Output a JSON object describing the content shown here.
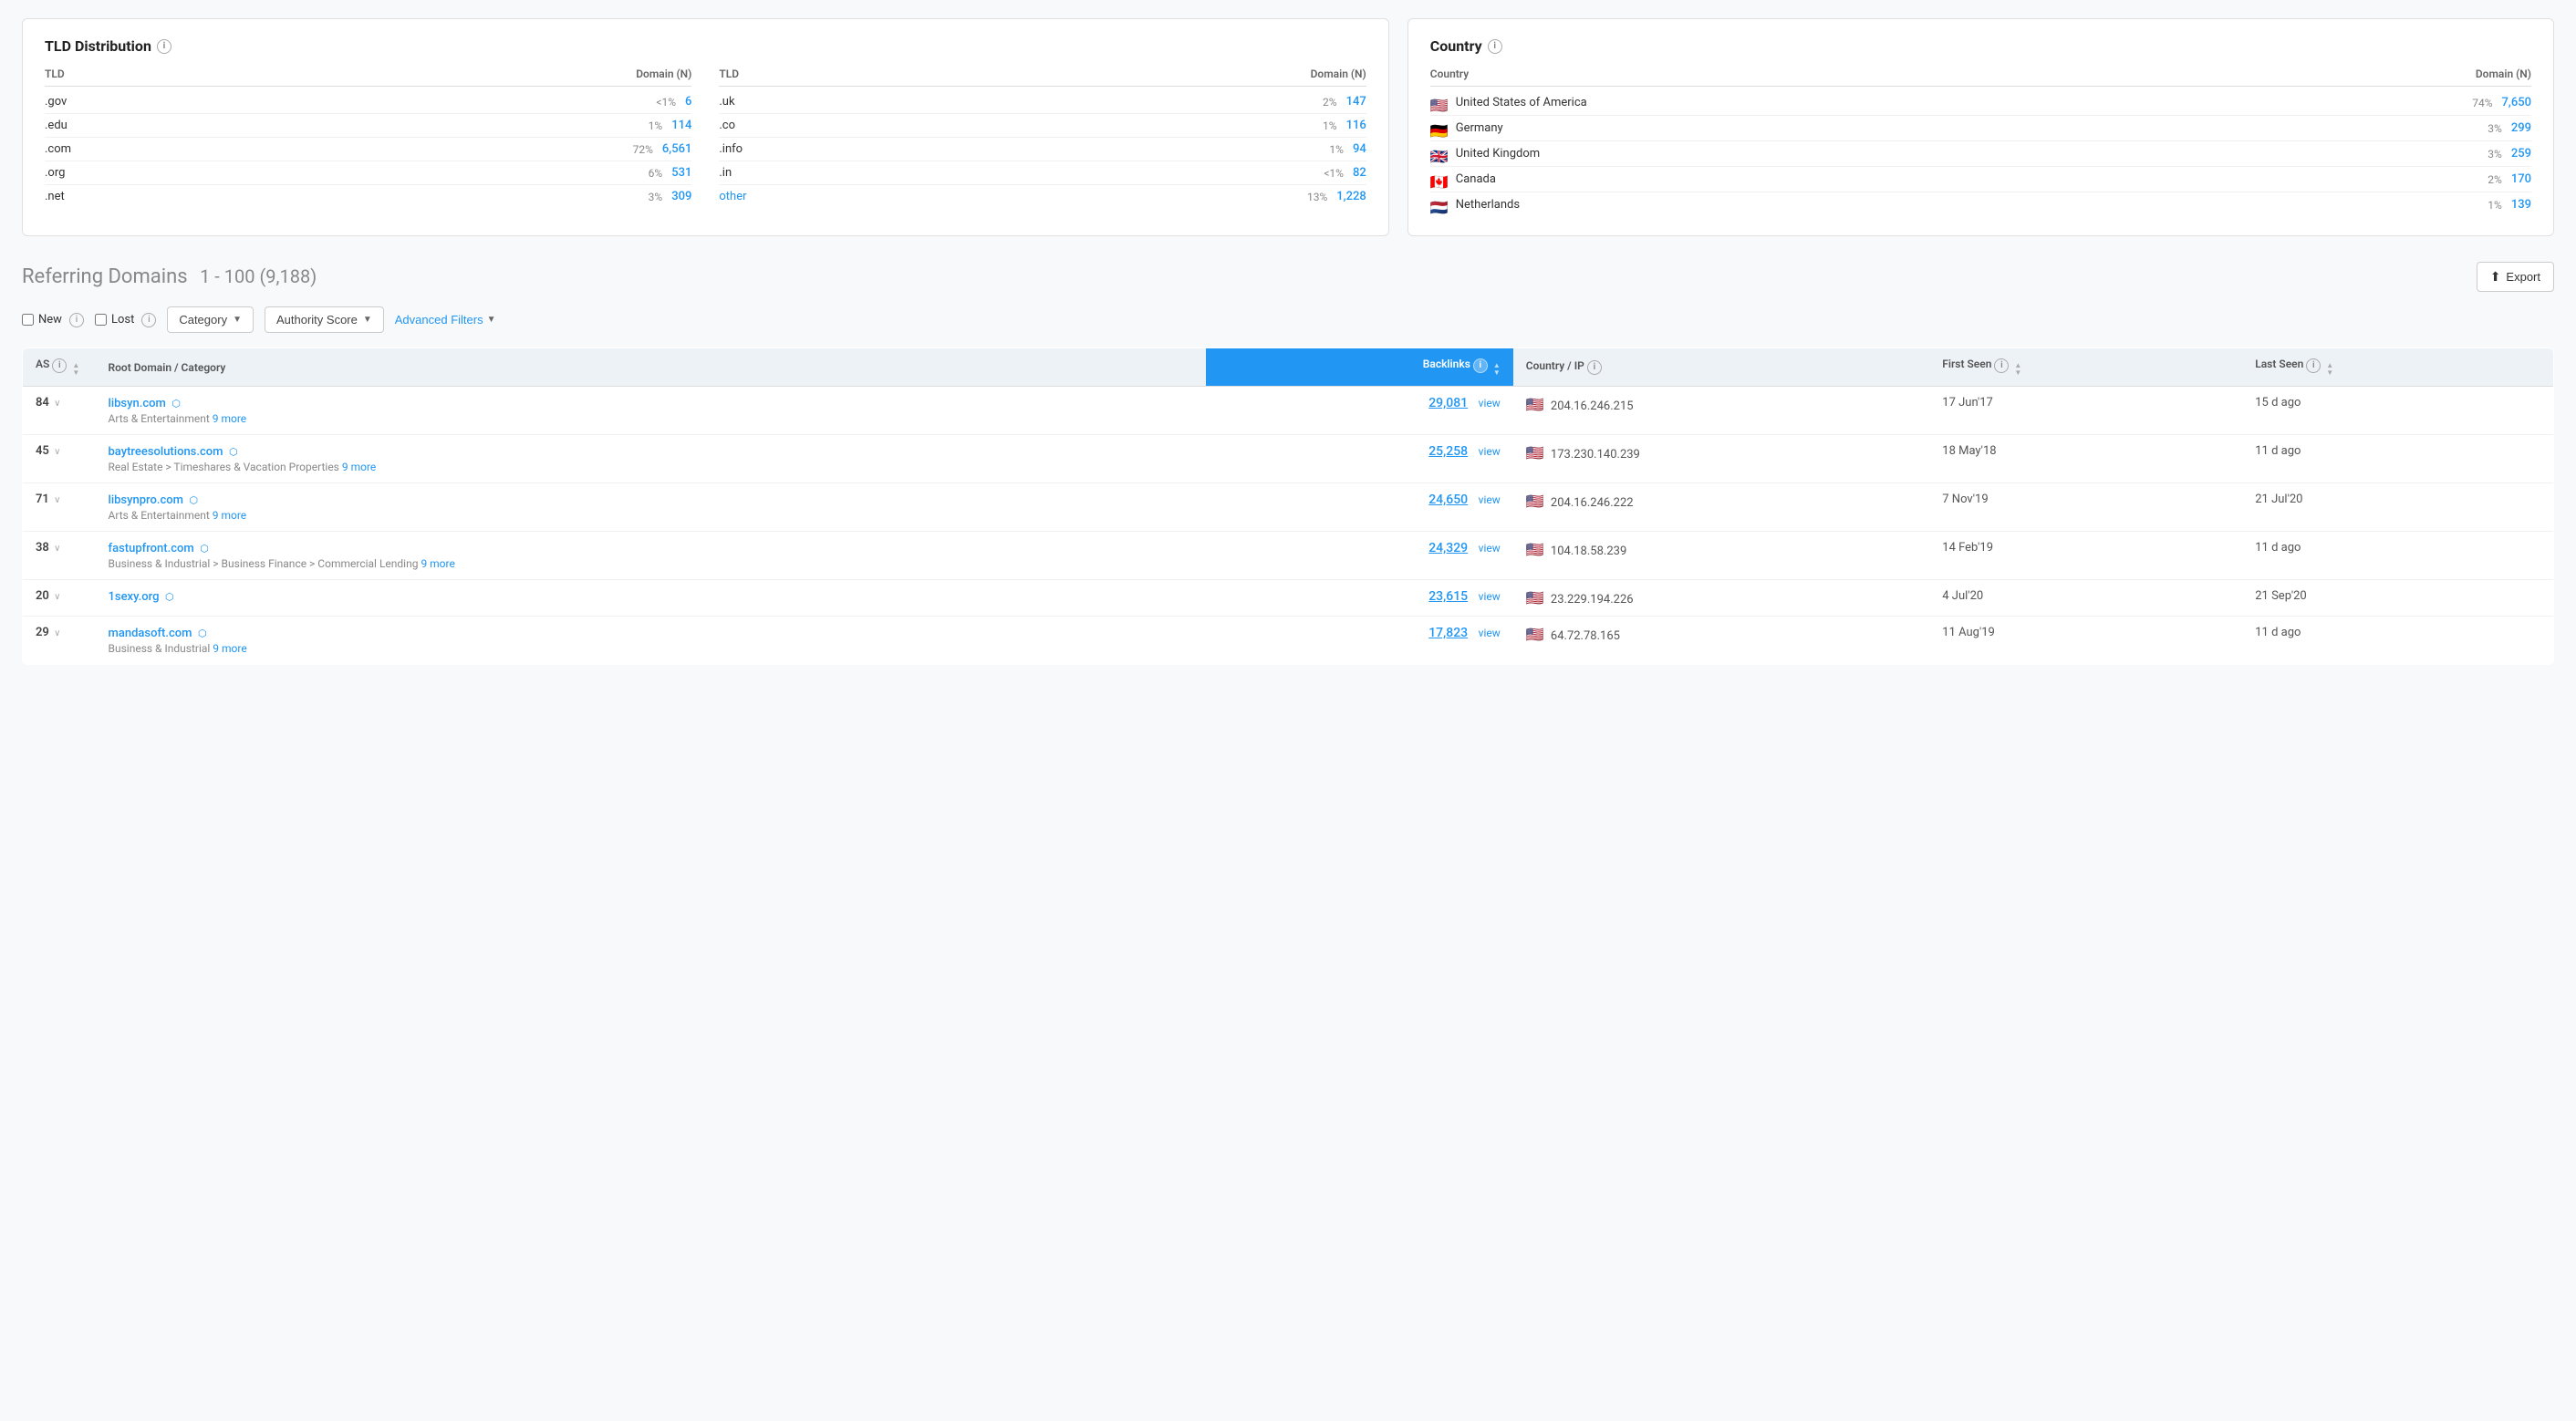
{
  "tld_section": {
    "title": "TLD Distribution",
    "col1": {
      "header_tld": "TLD",
      "header_domain": "Domain (N)",
      "rows": [
        {
          "tld": ".gov",
          "pct": "<1%",
          "count": "6"
        },
        {
          "tld": ".edu",
          "pct": "1%",
          "count": "114"
        },
        {
          "tld": ".com",
          "pct": "72%",
          "count": "6,561"
        },
        {
          "tld": ".org",
          "pct": "6%",
          "count": "531"
        },
        {
          "tld": ".net",
          "pct": "3%",
          "count": "309"
        }
      ]
    },
    "col2": {
      "header_tld": "TLD",
      "header_domain": "Domain (N)",
      "rows": [
        {
          "tld": ".uk",
          "pct": "2%",
          "count": "147"
        },
        {
          "tld": ".co",
          "pct": "1%",
          "count": "116"
        },
        {
          "tld": ".info",
          "pct": "1%",
          "count": "94"
        },
        {
          "tld": ".in",
          "pct": "<1%",
          "count": "82"
        },
        {
          "tld": "other",
          "pct": "13%",
          "count": "1,228",
          "is_link": true
        }
      ]
    }
  },
  "country_section": {
    "title": "Country",
    "header_country": "Country",
    "header_domain": "Domain (N)",
    "rows": [
      {
        "flag": "🇺🇸",
        "name": "United States of America",
        "pct": "74%",
        "count": "7,650"
      },
      {
        "flag": "🇩🇪",
        "name": "Germany",
        "pct": "3%",
        "count": "299"
      },
      {
        "flag": "🇬🇧",
        "name": "United Kingdom",
        "pct": "3%",
        "count": "259"
      },
      {
        "flag": "🇨🇦",
        "name": "Canada",
        "pct": "2%",
        "count": "170"
      },
      {
        "flag": "🇳🇱",
        "name": "Netherlands",
        "pct": "1%",
        "count": "139"
      }
    ]
  },
  "referring_domains": {
    "title": "Referring Domains",
    "range": "1 - 100 (9,188)",
    "export_label": "Export",
    "filters": {
      "new_label": "New",
      "lost_label": "Lost",
      "category_label": "Category",
      "authority_score_label": "Authority Score",
      "advanced_filters_label": "Advanced Filters"
    },
    "table": {
      "headers": [
        {
          "key": "as",
          "label": "AS",
          "sortable": true
        },
        {
          "key": "root_domain",
          "label": "Root Domain / Category",
          "sortable": false
        },
        {
          "key": "backlinks",
          "label": "Backlinks",
          "sortable": true,
          "highlight": true
        },
        {
          "key": "country_ip",
          "label": "Country / IP",
          "sortable": false
        },
        {
          "key": "first_seen",
          "label": "First Seen",
          "sortable": true
        },
        {
          "key": "last_seen",
          "label": "Last Seen",
          "sortable": true
        }
      ],
      "rows": [
        {
          "as": "84",
          "domain": "libsyn.com",
          "category": "Arts & Entertainment",
          "more": "9 more",
          "backlinks": "29,081",
          "flag": "🇺🇸",
          "ip": "204.16.246.215",
          "first_seen": "17 Jun'17",
          "last_seen": "15 d ago"
        },
        {
          "as": "45",
          "domain": "baytreesolutions.com",
          "category": "Real Estate > Timeshares & Vacation Properties",
          "more": "9 more",
          "backlinks": "25,258",
          "flag": "🇺🇸",
          "ip": "173.230.140.239",
          "first_seen": "18 May'18",
          "last_seen": "11 d ago"
        },
        {
          "as": "71",
          "domain": "libsynpro.com",
          "category": "Arts & Entertainment",
          "more": "9 more",
          "backlinks": "24,650",
          "flag": "🇺🇸",
          "ip": "204.16.246.222",
          "first_seen": "7 Nov'19",
          "last_seen": "21 Jul'20"
        },
        {
          "as": "38",
          "domain": "fastupfront.com",
          "category": "Business & Industrial > Business Finance > Commercial Lending",
          "more": "9 more",
          "backlinks": "24,329",
          "flag": "🇺🇸",
          "ip": "104.18.58.239",
          "first_seen": "14 Feb'19",
          "last_seen": "11 d ago"
        },
        {
          "as": "20",
          "domain": "1sexy.org",
          "category": "",
          "more": "",
          "backlinks": "23,615",
          "flag": "🇺🇸",
          "ip": "23.229.194.226",
          "first_seen": "4 Jul'20",
          "last_seen": "21 Sep'20"
        },
        {
          "as": "29",
          "domain": "mandasoft.com",
          "category": "Business & Industrial",
          "more": "9 more",
          "backlinks": "17,823",
          "flag": "🇺🇸",
          "ip": "64.72.78.165",
          "first_seen": "11 Aug'19",
          "last_seen": "11 d ago"
        }
      ]
    }
  }
}
